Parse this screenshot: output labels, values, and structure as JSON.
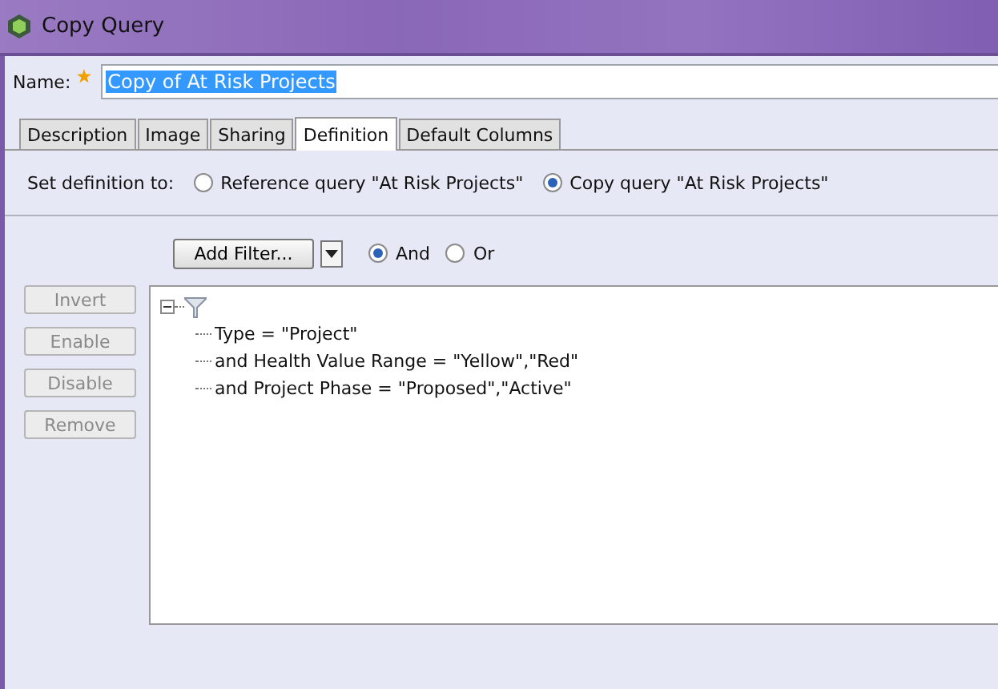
{
  "window": {
    "title": "Copy Query"
  },
  "name_field": {
    "label": "Name:",
    "value": "Copy of At Risk Projects",
    "required": true
  },
  "tabs": [
    {
      "label": "Description",
      "selected": false
    },
    {
      "label": "Image",
      "selected": false
    },
    {
      "label": "Sharing",
      "selected": false
    },
    {
      "label": "Definition",
      "selected": true
    },
    {
      "label": "Default Columns",
      "selected": false
    }
  ],
  "definition": {
    "label": "Set definition to:",
    "options": [
      {
        "label": "Reference query \"At Risk Projects\"",
        "selected": false
      },
      {
        "label": "Copy query \"At Risk Projects\"",
        "selected": true
      }
    ]
  },
  "filter_bar": {
    "add_button": "Add Filter...",
    "operators": [
      {
        "label": "And",
        "selected": true
      },
      {
        "label": "Or",
        "selected": false
      }
    ]
  },
  "side_buttons": [
    {
      "label": "Invert",
      "disabled": true
    },
    {
      "label": "Enable",
      "disabled": true
    },
    {
      "label": "Disable",
      "disabled": true
    },
    {
      "label": "Remove",
      "disabled": true
    }
  ],
  "filter_tree": {
    "expanded": true,
    "children": [
      {
        "label": "Type = \"Project\""
      },
      {
        "label": "and Health Value Range = \"Yellow\",\"Red\""
      },
      {
        "label": "and Project Phase = \"Proposed\",\"Active\""
      }
    ]
  }
}
